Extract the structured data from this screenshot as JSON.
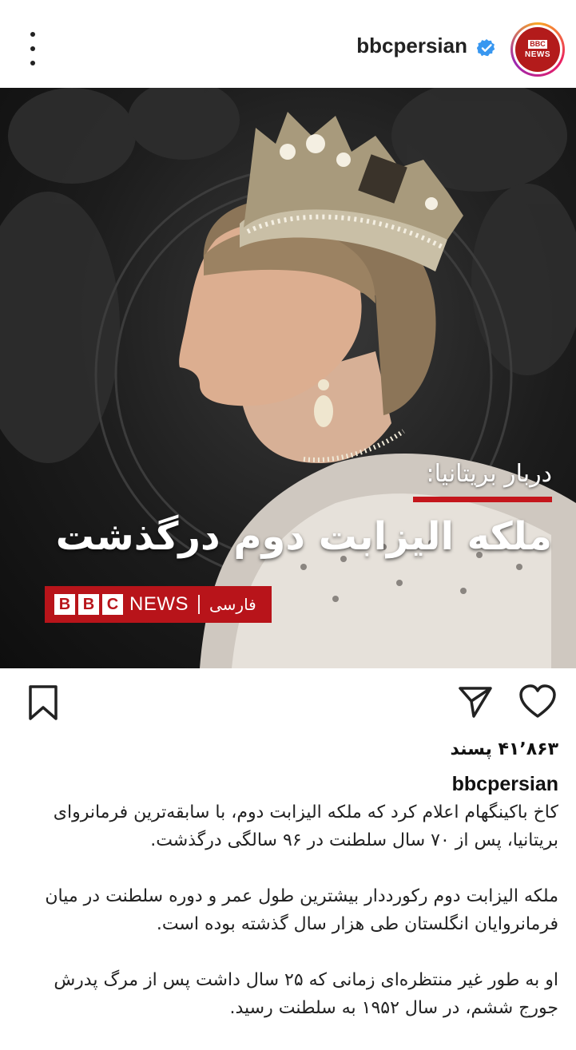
{
  "header": {
    "handle": "bbcpersian",
    "avatar_top": "BBC",
    "avatar_bottom": "NEWS"
  },
  "post": {
    "overline": "دربار بریتانیا:",
    "headline": "ملکه الیزابت دوم درگذشت",
    "brand_letters": [
      "B",
      "B",
      "C"
    ],
    "brand_news": "NEWS",
    "brand_lang": "فارسی"
  },
  "likes": "۴۱٬۸۶۳ پسند",
  "author": "bbcpersian",
  "caption": [
    "کاخ باکینگهام اعلام کرد که ملکه الیزابت دوم، با سابقه‌ترین فرمانروای بریتانیا، پس از ۷۰ سال سلطنت در ۹۶ سالگی درگذشت.",
    "ملکه الیزابت دوم رکورددار بیشترین طول عمر و دوره سلطنت در میان فرمانروایان انگلستان طی هزار سال گذشته بوده است.",
    "او به طور غیر منتظره‌ای زمانی که ۲۵ سال داشت پس از مرگ پدرش جورج ششم، در سال ۱۹۵۲ به سلطنت رسید."
  ],
  "colors": {
    "brand_red": "#b8141a",
    "verified_blue": "#3897f0"
  },
  "icons": [
    "more-icon",
    "verified-icon",
    "bookmark-icon",
    "share-icon",
    "heart-icon"
  ]
}
